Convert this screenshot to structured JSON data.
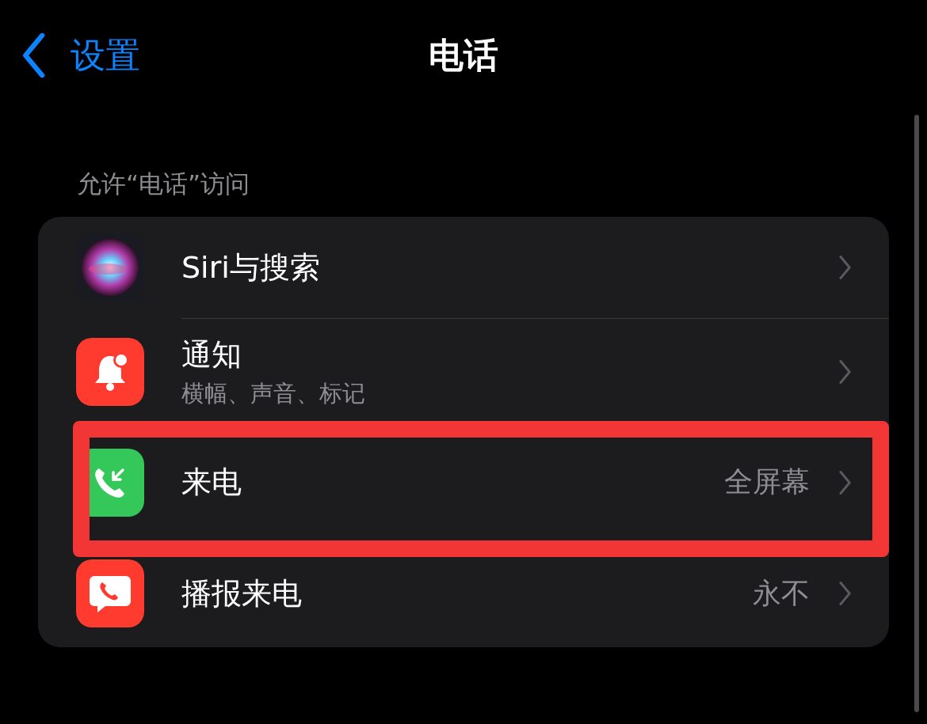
{
  "nav": {
    "back_label": "设置",
    "title": "电话"
  },
  "section_header": "允许“电话”访问",
  "rows": [
    {
      "kind": "siri",
      "label": "Siri与搜索",
      "highlighted": false
    },
    {
      "kind": "notifications",
      "label": "通知",
      "subtitle": "横幅、声音、标记",
      "highlighted": false
    },
    {
      "kind": "incoming",
      "label": "来电",
      "value": "全屏幕",
      "highlighted": true
    },
    {
      "kind": "announce",
      "label": "播报来电",
      "value": "永不",
      "highlighted": false
    }
  ]
}
